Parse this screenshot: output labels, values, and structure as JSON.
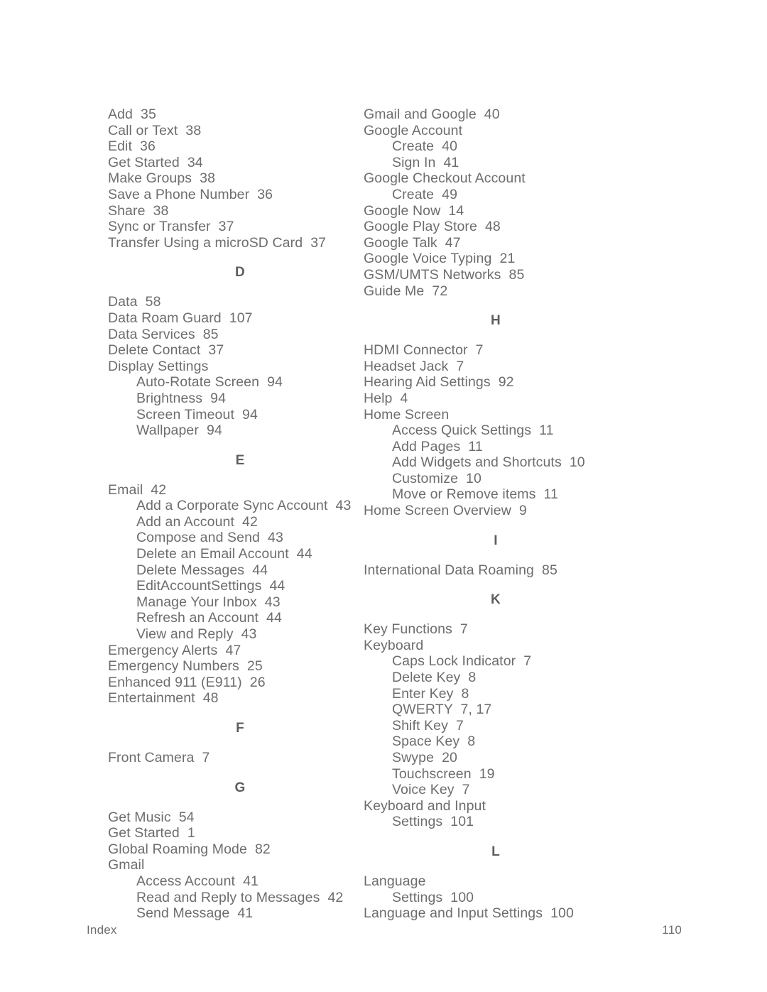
{
  "document": {
    "type": "index",
    "footer": {
      "label": "Index",
      "page_number": "110"
    },
    "text_color": "#6d6d6d",
    "heading_color": "#5e5e5e"
  },
  "columns": [
    {
      "name": "left-column",
      "blocks": [
        {
          "kind": "entries",
          "items": [
            {
              "text": "Add  35",
              "level": "main"
            },
            {
              "text": "Call or Text  38",
              "level": "main"
            },
            {
              "text": "Edit  36",
              "level": "main"
            },
            {
              "text": "Get Started  34",
              "level": "main"
            },
            {
              "text": "Make Groups  38",
              "level": "main"
            },
            {
              "text": "Save a Phone Number  36",
              "level": "main"
            },
            {
              "text": "Share  38",
              "level": "main"
            },
            {
              "text": "Sync or Transfer  37",
              "level": "main"
            },
            {
              "text": "Transfer Using a microSD Card  37",
              "level": "main"
            }
          ]
        },
        {
          "kind": "letter",
          "letter": "D"
        },
        {
          "kind": "entries",
          "items": [
            {
              "text": "Data  58",
              "level": "main"
            },
            {
              "text": "Data Roam Guard  107",
              "level": "main"
            },
            {
              "text": "Data Services  85",
              "level": "main"
            },
            {
              "text": "Delete Contact  37",
              "level": "main"
            },
            {
              "text": "Display Settings",
              "level": "main"
            },
            {
              "text": "Auto-Rotate Screen  94",
              "level": "sub"
            },
            {
              "text": "Brightness  94",
              "level": "sub"
            },
            {
              "text": "Screen Timeout  94",
              "level": "sub"
            },
            {
              "text": "Wallpaper  94",
              "level": "sub"
            }
          ]
        },
        {
          "kind": "letter",
          "letter": "E"
        },
        {
          "kind": "entries",
          "items": [
            {
              "text": "Email  42",
              "level": "main"
            },
            {
              "text": "Add a Corporate Sync Account  43",
              "level": "sub"
            },
            {
              "text": "Add an Account  42",
              "level": "sub"
            },
            {
              "text": "Compose and Send  43",
              "level": "sub"
            },
            {
              "text": "Delete an Email Account  44",
              "level": "sub"
            },
            {
              "text": "Delete Messages  44",
              "level": "sub"
            },
            {
              "text": "EditAccountSettings  44",
              "level": "sub"
            },
            {
              "text": "Manage Your Inbox  43",
              "level": "sub"
            },
            {
              "text": "Refresh an Account  44",
              "level": "sub"
            },
            {
              "text": "View and Reply  43",
              "level": "sub"
            },
            {
              "text": "Emergency Alerts  47",
              "level": "main"
            },
            {
              "text": "Emergency Numbers  25",
              "level": "main"
            },
            {
              "text": "Enhanced 911 (E911)  26",
              "level": "main"
            },
            {
              "text": "Entertainment  48",
              "level": "main"
            }
          ]
        },
        {
          "kind": "letter",
          "letter": "F"
        },
        {
          "kind": "entries",
          "items": [
            {
              "text": "Front Camera  7",
              "level": "main"
            }
          ]
        },
        {
          "kind": "letter",
          "letter": "G"
        },
        {
          "kind": "entries",
          "items": [
            {
              "text": "Get Music  54",
              "level": "main"
            },
            {
              "text": "Get Started  1",
              "level": "main"
            },
            {
              "text": "Global Roaming Mode  82",
              "level": "main"
            },
            {
              "text": "Gmail",
              "level": "main"
            },
            {
              "text": "Access Account  41",
              "level": "sub"
            },
            {
              "text": "Read and Reply to Messages  42",
              "level": "sub"
            },
            {
              "text": "Send Message  41",
              "level": "sub"
            }
          ]
        }
      ]
    },
    {
      "name": "right-column",
      "blocks": [
        {
          "kind": "entries",
          "items": [
            {
              "text": "Gmail and Google  40",
              "level": "main"
            },
            {
              "text": "Google Account",
              "level": "main"
            },
            {
              "text": "Create  40",
              "level": "sub"
            },
            {
              "text": "Sign In  41",
              "level": "sub"
            },
            {
              "text": "Google Checkout Account",
              "level": "main"
            },
            {
              "text": "Create  49",
              "level": "sub"
            },
            {
              "text": "Google Now  14",
              "level": "main"
            },
            {
              "text": "Google Play Store  48",
              "level": "main"
            },
            {
              "text": "Google Talk  47",
              "level": "main"
            },
            {
              "text": "Google Voice Typing  21",
              "level": "main"
            },
            {
              "text": "GSM/UMTS Networks  85",
              "level": "main"
            },
            {
              "text": "Guide Me  72",
              "level": "main"
            }
          ]
        },
        {
          "kind": "letter",
          "letter": "H"
        },
        {
          "kind": "entries",
          "items": [
            {
              "text": "HDMI Connector  7",
              "level": "main"
            },
            {
              "text": "Headset Jack  7",
              "level": "main"
            },
            {
              "text": "Hearing Aid Settings  92",
              "level": "main"
            },
            {
              "text": "Help  4",
              "level": "main"
            },
            {
              "text": "Home Screen",
              "level": "main"
            },
            {
              "text": "Access Quick Settings  11",
              "level": "sub"
            },
            {
              "text": "Add Pages  11",
              "level": "sub"
            },
            {
              "text": "Add Widgets and Shortcuts  10",
              "level": "sub"
            },
            {
              "text": "Customize  10",
              "level": "sub"
            },
            {
              "text": "Move or Remove items  11",
              "level": "sub"
            },
            {
              "text": "Home Screen Overview  9",
              "level": "main"
            }
          ]
        },
        {
          "kind": "letter",
          "letter": "I"
        },
        {
          "kind": "entries",
          "items": [
            {
              "text": "International Data Roaming  85",
              "level": "main"
            }
          ]
        },
        {
          "kind": "letter",
          "letter": "K"
        },
        {
          "kind": "entries",
          "items": [
            {
              "text": "Key Functions  7",
              "level": "main"
            },
            {
              "text": "Keyboard",
              "level": "main"
            },
            {
              "text": "Caps Lock Indicator  7",
              "level": "sub"
            },
            {
              "text": "Delete Key  8",
              "level": "sub"
            },
            {
              "text": "Enter Key  8",
              "level": "sub"
            },
            {
              "text": "QWERTY  7, 17",
              "level": "sub"
            },
            {
              "text": "Shift Key  7",
              "level": "sub"
            },
            {
              "text": "Space Key  8",
              "level": "sub"
            },
            {
              "text": "Swype  20",
              "level": "sub"
            },
            {
              "text": "Touchscreen  19",
              "level": "sub"
            },
            {
              "text": "Voice Key  7",
              "level": "sub"
            },
            {
              "text": "Keyboard and Input",
              "level": "main"
            },
            {
              "text": "Settings  101",
              "level": "sub"
            }
          ]
        },
        {
          "kind": "letter",
          "letter": "L"
        },
        {
          "kind": "entries",
          "items": [
            {
              "text": "Language",
              "level": "main"
            },
            {
              "text": "Settings  100",
              "level": "sub"
            },
            {
              "text": "Language and Input Settings  100",
              "level": "main"
            }
          ]
        }
      ]
    }
  ]
}
